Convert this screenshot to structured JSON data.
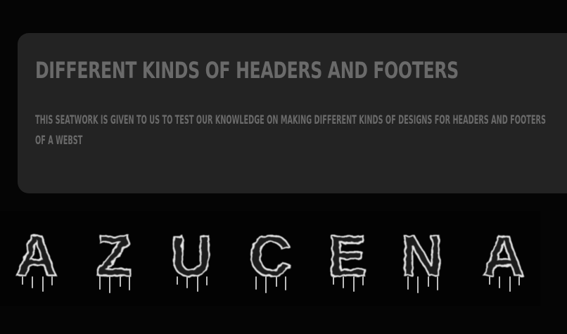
{
  "card": {
    "title": "Different Kinds of Headers and Footers",
    "description": "This seatwork is given to us to test our knowledge on making different kinds of designs for headers and footers of a webst"
  },
  "banner": {
    "logo_text": "AZUCENA",
    "letters": [
      "A",
      "Z",
      "U",
      "C",
      "E",
      "N",
      "A"
    ]
  },
  "colors": {
    "page_background": "#050505",
    "card_background": "#232323",
    "card_text": "#6a6a6a",
    "logo_stroke": "#e8e8e8"
  }
}
